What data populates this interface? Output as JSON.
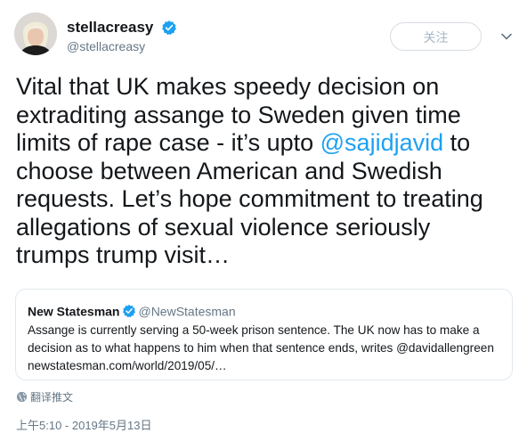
{
  "author": {
    "display_name": "stellacreasy",
    "handle": "@stellacreasy",
    "verified": true
  },
  "follow_button": {
    "label": "关注"
  },
  "tweet": {
    "segments": [
      {
        "text": "Vital that UK makes speedy decision on extraditing assange to Sweden given time limits of rape case - it’s upto ",
        "mention": false
      },
      {
        "text": "@sajidjavid",
        "mention": true
      },
      {
        "text": " to choose between American and Swedish requests. Let’s hope commitment to treating allegations of sexual violence seriously trumps trump visit…",
        "mention": false
      }
    ]
  },
  "quoted_tweet": {
    "author_name": "New Statesman",
    "author_handle": "@NewStatesman",
    "verified": true,
    "body": "Assange is currently serving a 50-week prison sentence. The UK now has to make a decision as to what happens to him when that sentence ends, writes @davidallengreen newstatesman.com/world/2019/05/…"
  },
  "translate_link": {
    "label": "翻译推文",
    "icon": "globe-icon"
  },
  "timestamp": "上午5:10 - 2019年5月13日",
  "colors": {
    "accent": "#1da1f2",
    "text": "#14171a",
    "secondary_text": "#657786",
    "border": "#e1e8ed"
  }
}
